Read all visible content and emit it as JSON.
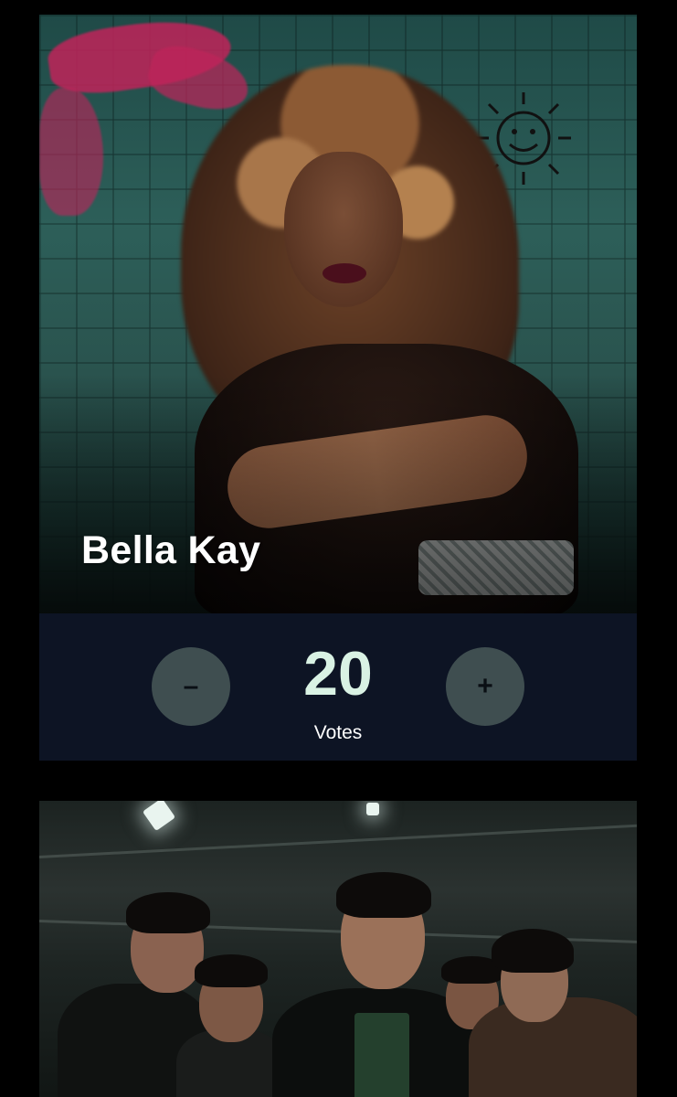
{
  "cards": [
    {
      "artist_name": "Bella Kay",
      "votes": {
        "count": "20",
        "label": "Votes",
        "decrement_label": "–",
        "increment_label": "+"
      }
    },
    {
      "artist_name": ""
    }
  ],
  "colors": {
    "page_background": "#000000",
    "vote_bar_background": "#0d1424",
    "vote_button_background": "#3f4e50",
    "vote_count_color": "#d9f2e4",
    "label_color": "#ffffff"
  }
}
